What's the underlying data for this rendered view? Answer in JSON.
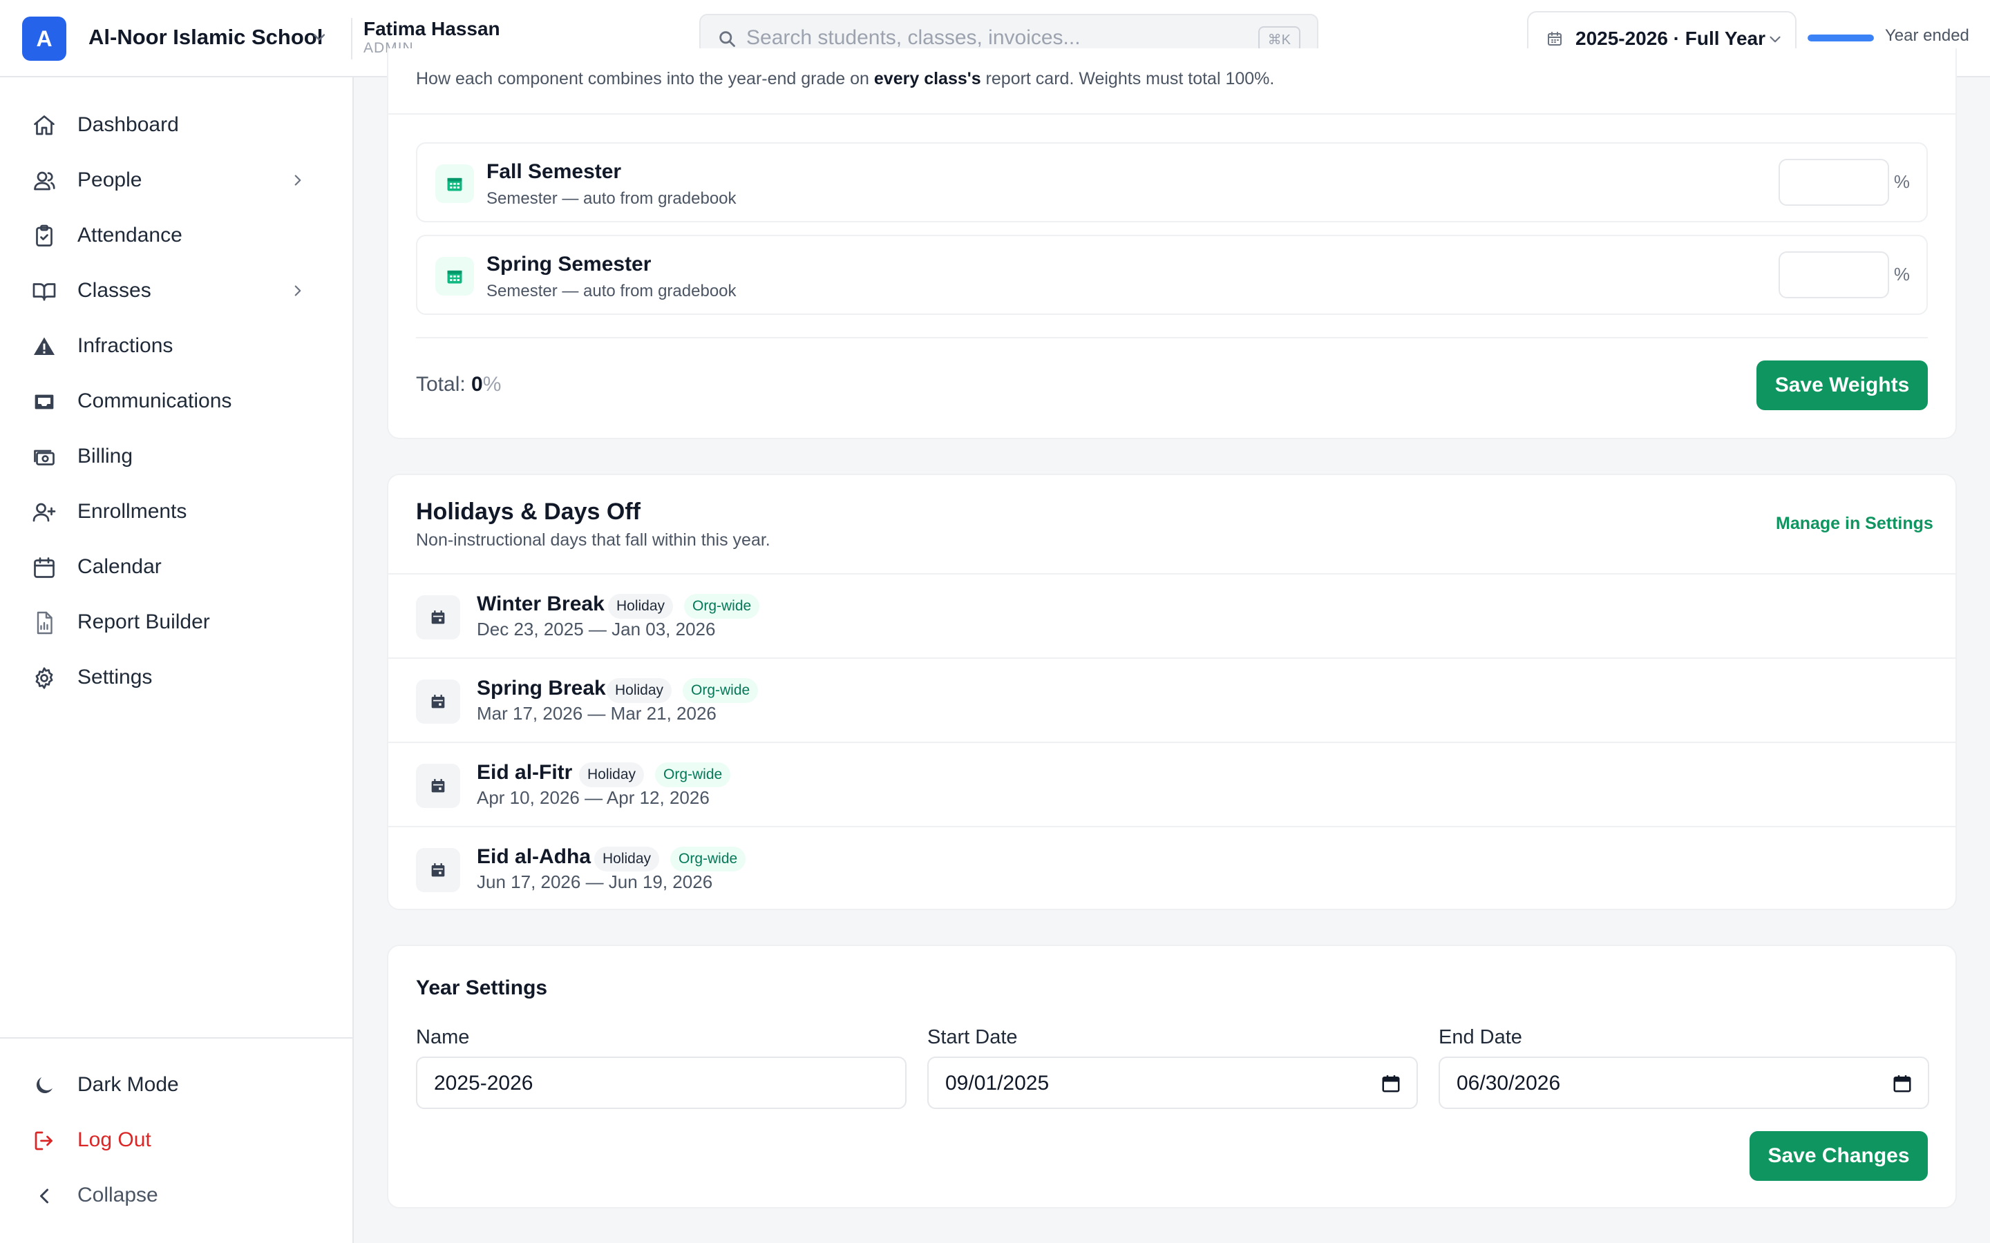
{
  "topbar": {
    "org_initial": "A",
    "org_name": "Al-Noor Islamic School",
    "user_name": "Fatima Hassan",
    "user_role": "ADMIN",
    "search_placeholder": "Search students, classes, invoices...",
    "search_shortcut": "⌘K",
    "year_label": "2025-2026 · Full Year",
    "year_status": "Year ended",
    "year_progress": 1.0
  },
  "sidebar": {
    "items": [
      {
        "label": "Dashboard",
        "icon": "home-icon"
      },
      {
        "label": "People",
        "icon": "users-icon"
      },
      {
        "label": "Attendance",
        "icon": "clipboard-check-icon"
      },
      {
        "label": "Classes",
        "icon": "book-open-icon"
      },
      {
        "label": "Infractions",
        "icon": "warning-icon"
      },
      {
        "label": "Communications",
        "icon": "inbox-icon"
      },
      {
        "label": "Billing",
        "icon": "billing-icon"
      },
      {
        "label": "Enrollments",
        "icon": "user-plus-icon"
      },
      {
        "label": "Calendar",
        "icon": "calendar-icon"
      },
      {
        "label": "Report Builder",
        "icon": "report-icon"
      },
      {
        "label": "Settings",
        "icon": "gear-icon"
      }
    ],
    "dark_mode": "Dark Mode",
    "logout": "Log Out",
    "collapse": "Collapse"
  },
  "weights": {
    "description_pre": "How each component combines into the year-end grade on ",
    "description_bold": "every class's",
    "description_post": " report card. Weights must total 100%.",
    "components": [
      {
        "title": "Fall Semester",
        "subtitle": "Semester — auto from gradebook",
        "value": "",
        "unit": "%"
      },
      {
        "title": "Spring Semester",
        "subtitle": "Semester — auto from gradebook",
        "value": "",
        "unit": "%"
      }
    ],
    "total_label": "Total: ",
    "total_value": "0",
    "total_unit": "%",
    "save_label": "Save Weights"
  },
  "holidays": {
    "title": "Holidays & Days Off",
    "subtitle": "Non-instructional days that fall within this year.",
    "manage_link": "Manage in Settings",
    "items": [
      {
        "name": "Winter Break",
        "type": "Holiday",
        "scope": "Org-wide",
        "dates": "Dec 23, 2025 — Jan 03, 2026"
      },
      {
        "name": "Spring Break",
        "type": "Holiday",
        "scope": "Org-wide",
        "dates": "Mar 17, 2026 — Mar 21, 2026"
      },
      {
        "name": "Eid al-Fitr",
        "type": "Holiday",
        "scope": "Org-wide",
        "dates": "Apr 10, 2026 — Apr 12, 2026"
      },
      {
        "name": "Eid al-Adha",
        "type": "Holiday",
        "scope": "Org-wide",
        "dates": "Jun 17, 2026 — Jun 19, 2026"
      }
    ]
  },
  "year_settings": {
    "title": "Year Settings",
    "name_label": "Name",
    "name_value": "2025-2026",
    "start_label": "Start Date",
    "start_value": "09/01/2025",
    "end_label": "End Date",
    "end_value": "06/30/2026",
    "save_label": "Save Changes"
  },
  "colors": {
    "brand_blue": "#2563eb",
    "accent_green": "#0e9560",
    "danger_red": "#dc2626"
  }
}
